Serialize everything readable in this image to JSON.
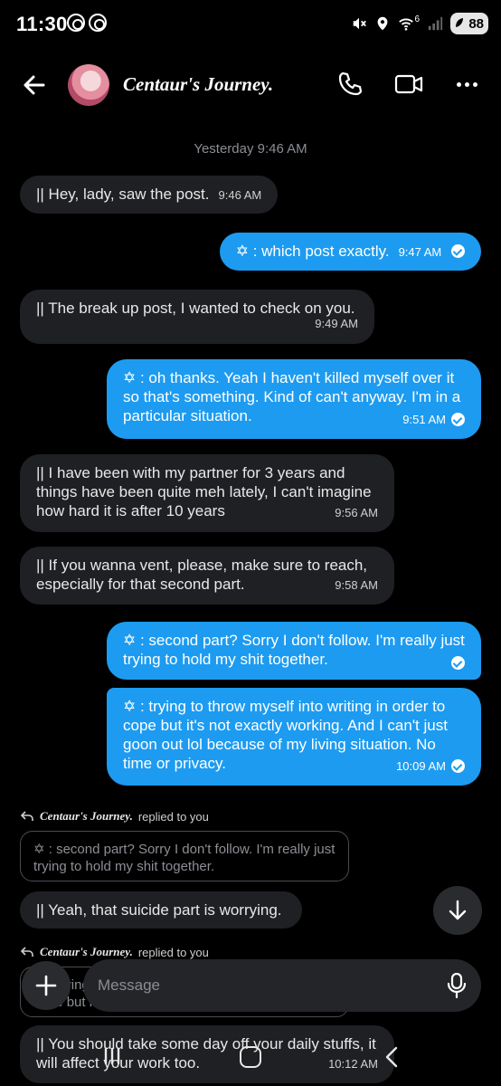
{
  "status_bar": {
    "time": "11:30",
    "network": "6",
    "battery": "88"
  },
  "header": {
    "title": "Centaur's Journey.",
    "back": "back-arrow-icon",
    "call": "phone-icon",
    "video": "video-icon",
    "more": "more-dots-icon"
  },
  "date_separator": "Yesterday 9:46 AM",
  "messages": [
    {
      "dir": "in",
      "text": "|| Hey, lady, saw the post.",
      "time": "9:46 AM"
    },
    {
      "dir": "out",
      "text": "✡︎ : which post exactly.",
      "time": "9:47 AM"
    },
    {
      "dir": "in",
      "text": "|| The break up post, I wanted to check on you.",
      "time": "9:49 AM"
    },
    {
      "dir": "out",
      "text": "✡︎ : oh thanks. Yeah I haven't killed myself over it so that's something. Kind of can't anyway. I'm in a particular situation.",
      "time": "9:51 AM"
    },
    {
      "dir": "in",
      "text": "|| I have been with my partner for 3 years and things have been quite meh lately, I can't imagine how hard it is after 10 years",
      "time": "9:56 AM"
    },
    {
      "dir": "in",
      "text": "|| If you wanna vent, please, make sure to reach, especially for that second part.",
      "time": "9:58 AM"
    },
    {
      "dir": "out",
      "text": "✡︎ : second part? Sorry I don't follow. I'm really just trying to hold my shit together.",
      "time": ""
    },
    {
      "dir": "out",
      "text": "✡︎ : trying to throw myself into writing in order to cope but it's not exactly working. And I can't just goon out lol because of my living situation. No time or privacy.",
      "time": "10:09 AM"
    }
  ],
  "reply1": {
    "name": "Centaur's Journey.",
    "suffix": "replied to you",
    "quote": "✡︎ : second part? Sorry I don't follow. I'm really just trying to hold my shit together.",
    "text": "|| Yeah, that suicide part is worrying."
  },
  "reply2": {
    "name": "Centaur's Journey.",
    "suffix": "replied to you",
    "quote": "✡︎ : trying to throw myself into writing in order to cope but it's not exactly working.",
    "text": "|| You should take some day off your daily stuffs, it will affect your work too.",
    "time": "10:12 AM"
  },
  "composer": {
    "placeholder": "Message"
  }
}
